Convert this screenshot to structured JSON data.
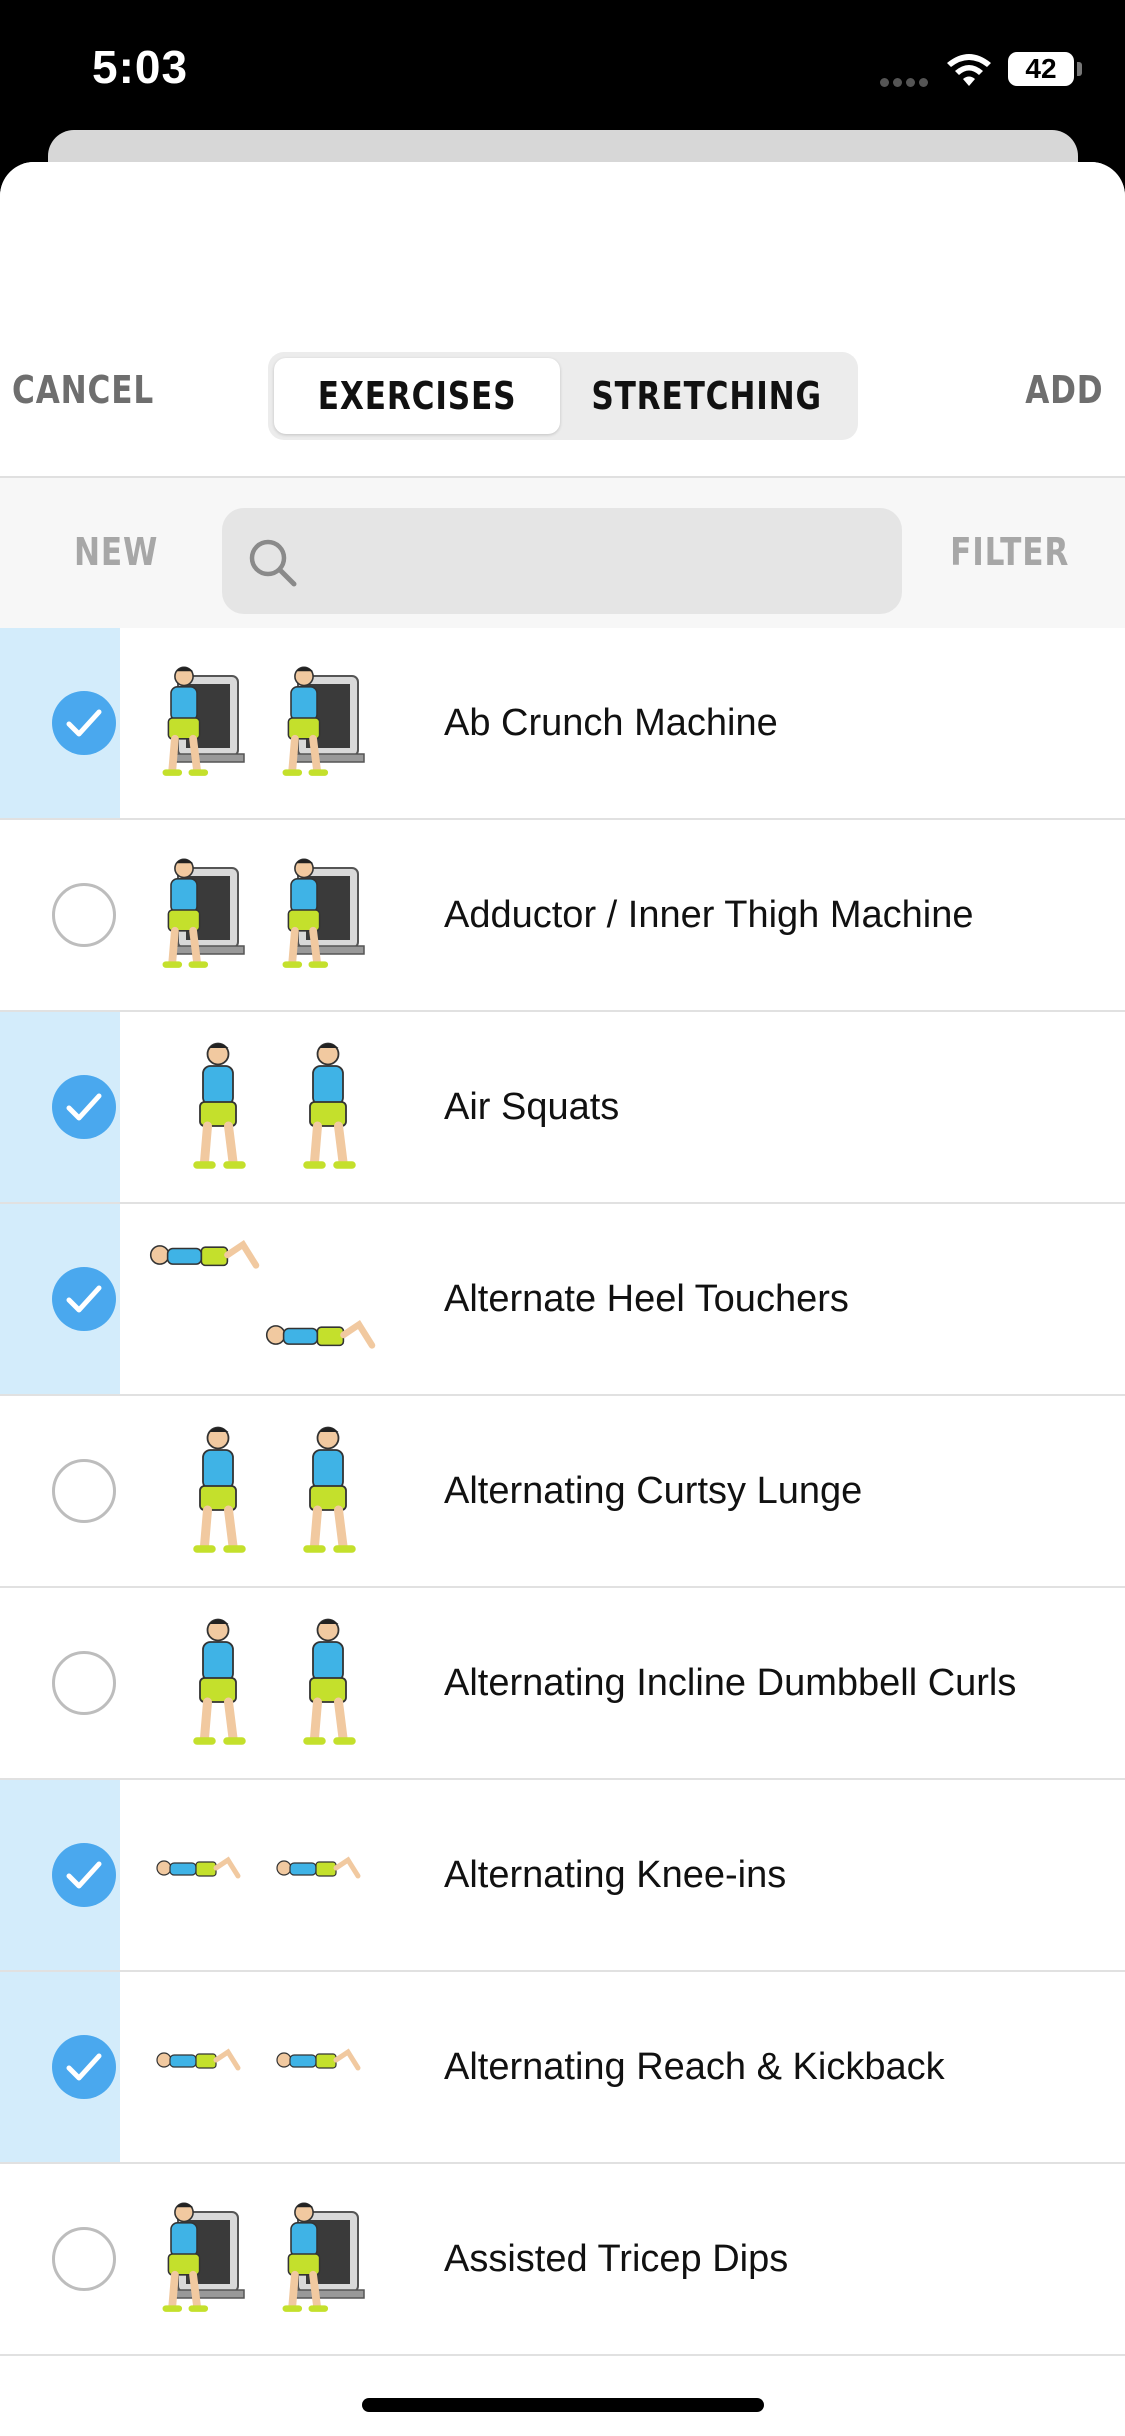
{
  "status_bar": {
    "time": "5:03",
    "battery": "42"
  },
  "header": {
    "cancel_label": "CANCEL",
    "add_label": "ADD",
    "tabs": [
      {
        "label": "EXERCISES",
        "selected": true
      },
      {
        "label": "STRETCHING",
        "selected": false
      }
    ]
  },
  "search": {
    "new_label": "NEW",
    "filter_label": "FILTER",
    "placeholder": "",
    "value": ""
  },
  "colors": {
    "accent": "#4aa8ee",
    "selected_row": "#d3ecfb",
    "shirt": "#3fb3e6",
    "shorts": "#c4e02c"
  },
  "exercises": [
    {
      "name": "Ab Crunch Machine",
      "checked": true,
      "thumbnail_icon": "ab-crunch-machine-illustration"
    },
    {
      "name": "Adductor / Inner Thigh Machine",
      "checked": false,
      "thumbnail_icon": "adductor-machine-illustration"
    },
    {
      "name": "Air Squats",
      "checked": true,
      "thumbnail_icon": "air-squats-illustration"
    },
    {
      "name": "Alternate Heel Touchers",
      "checked": true,
      "thumbnail_icon": "heel-touchers-illustration"
    },
    {
      "name": "Alternating Curtsy Lunge",
      "checked": false,
      "thumbnail_icon": "curtsy-lunge-illustration"
    },
    {
      "name": "Alternating Incline Dumbbell Curls",
      "checked": false,
      "thumbnail_icon": "incline-dumbbell-curls-illustration"
    },
    {
      "name": "Alternating Knee-ins",
      "checked": true,
      "thumbnail_icon": "knee-ins-illustration"
    },
    {
      "name": "Alternating Reach & Kickback",
      "checked": true,
      "thumbnail_icon": "reach-kickback-illustration"
    },
    {
      "name": "Assisted Tricep Dips",
      "checked": false,
      "thumbnail_icon": "tricep-dips-illustration"
    }
  ]
}
